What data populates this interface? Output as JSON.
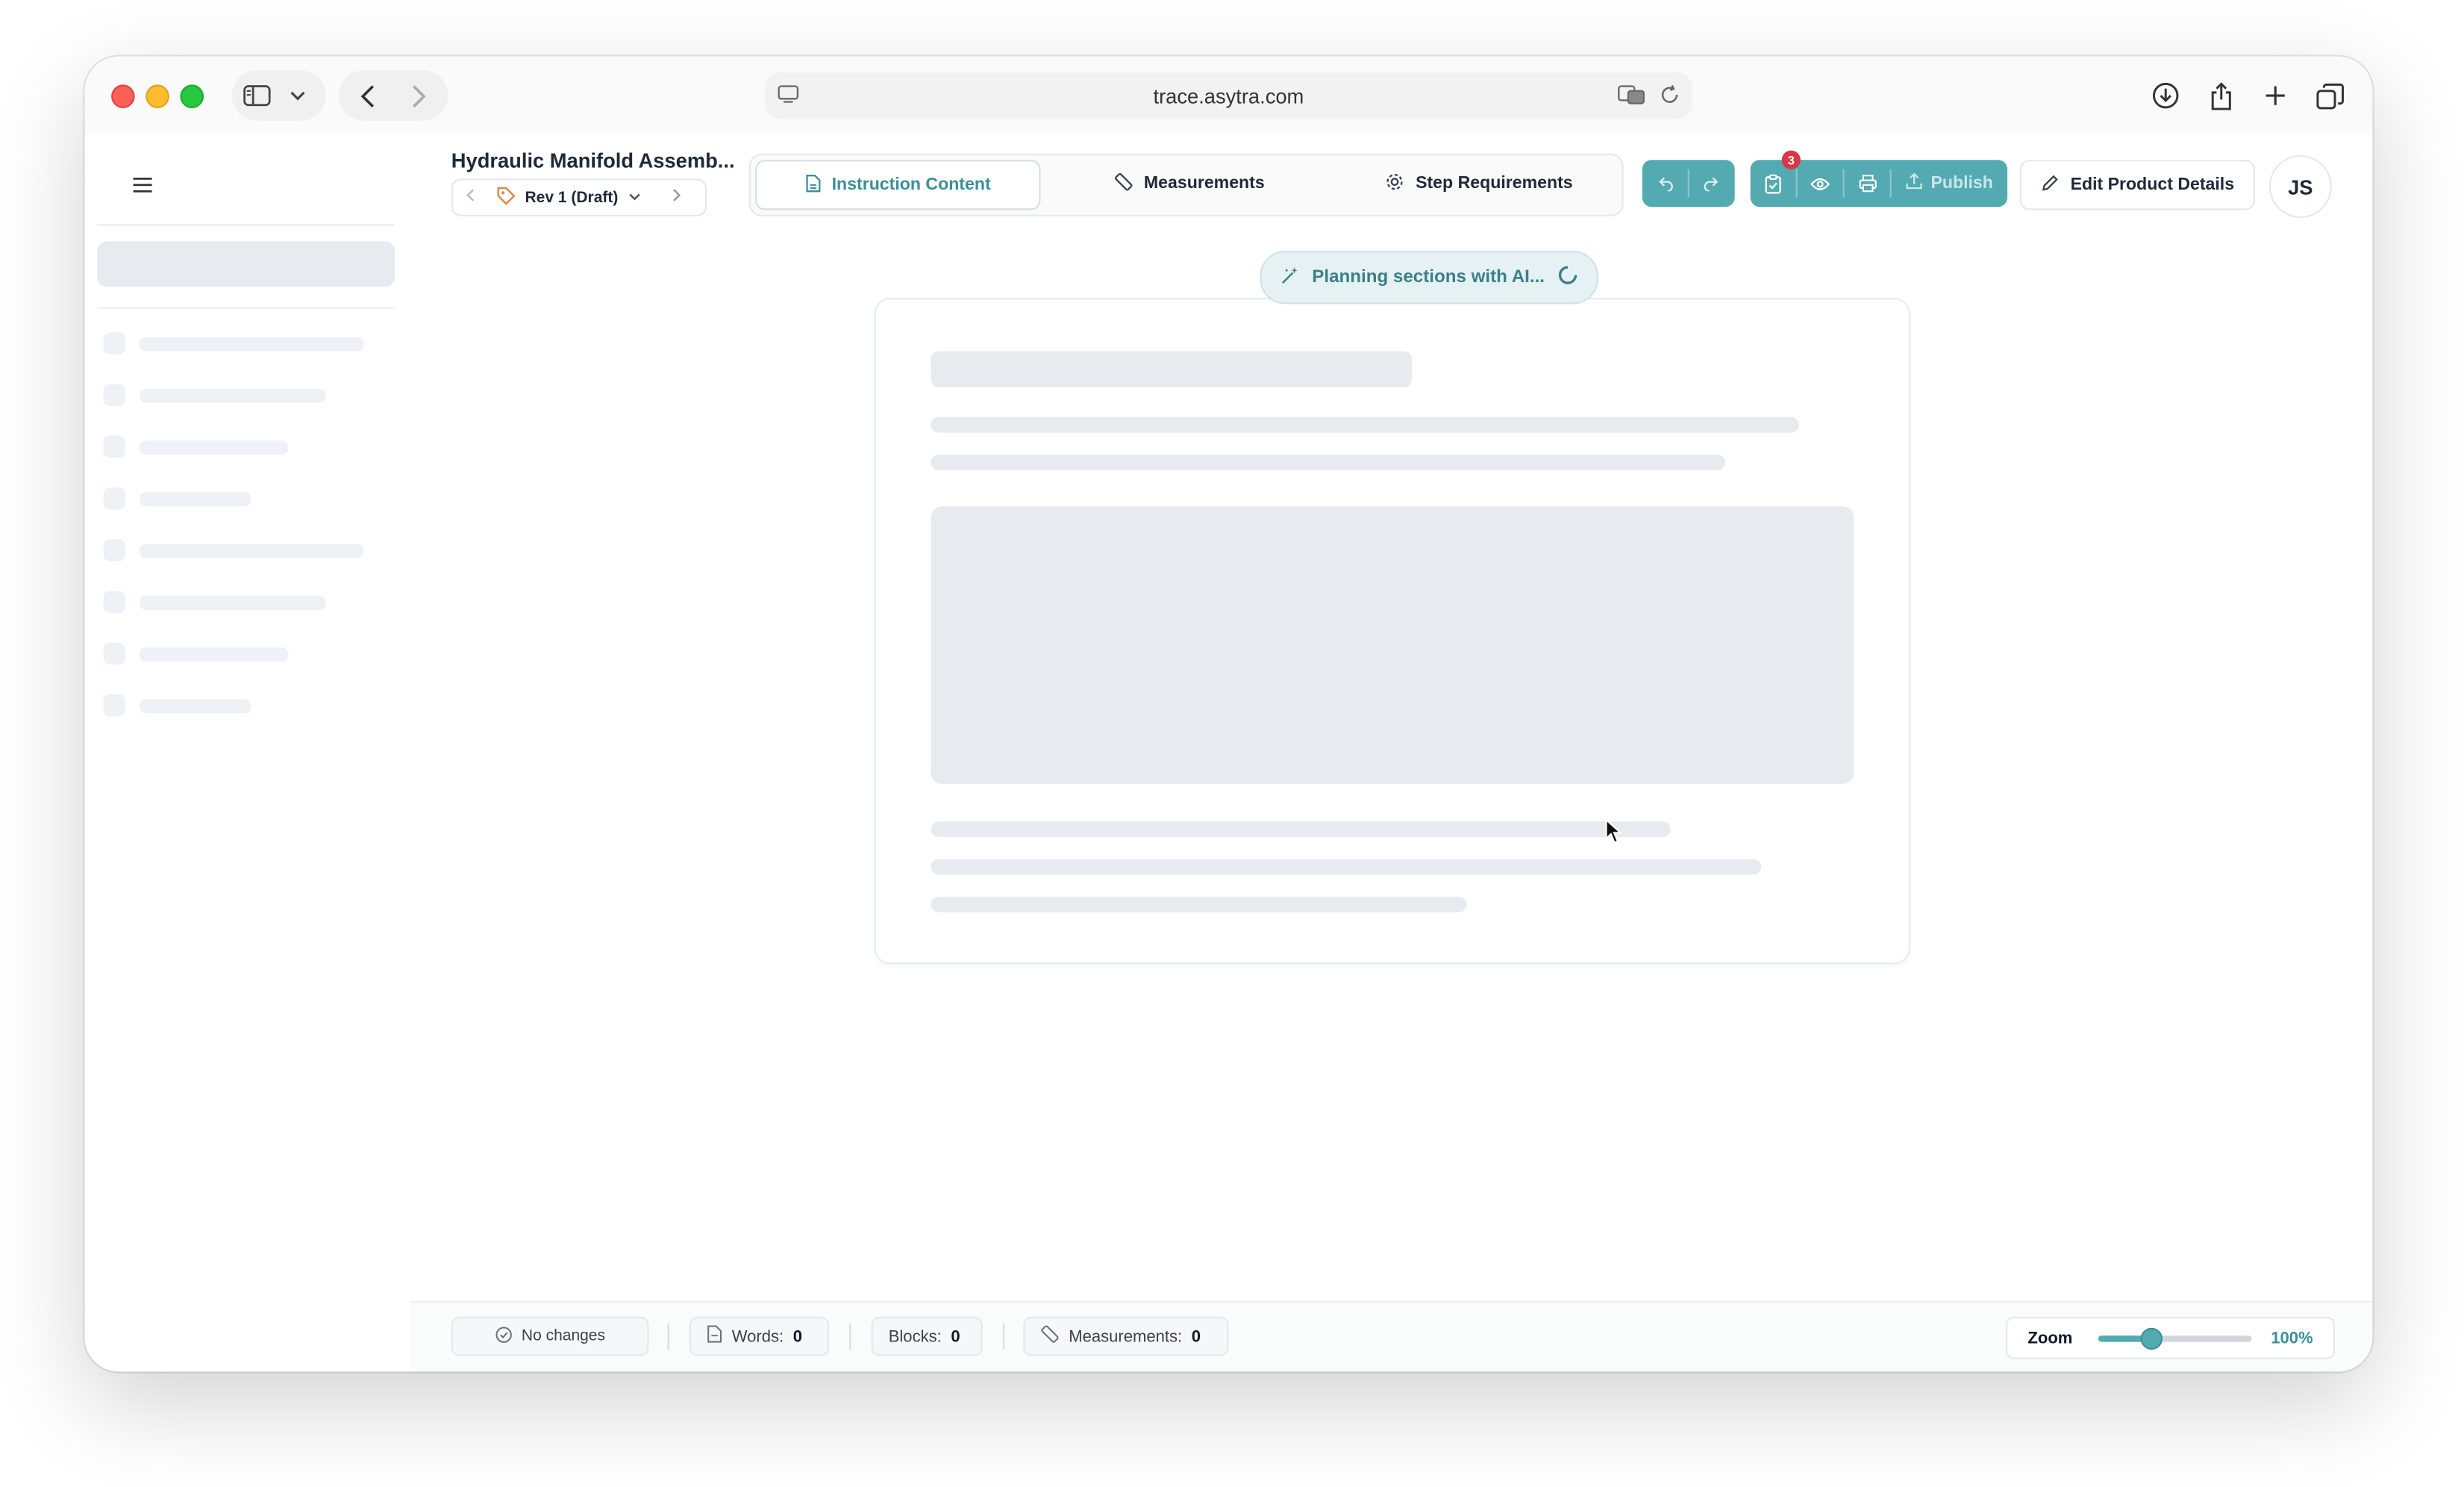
{
  "browser": {
    "url": "trace.asytra.com"
  },
  "header": {
    "product_title": "Hydraulic Manifold Assemb...",
    "revision": "Rev 1 (Draft)",
    "tabs": [
      {
        "label": "Instruction Content",
        "icon": "document-icon",
        "active": true
      },
      {
        "label": "Measurements",
        "icon": "ruler-icon",
        "active": false
      },
      {
        "label": "Step Requirements",
        "icon": "gear-icon",
        "active": false
      }
    ],
    "notification_count": "3",
    "publish_label": "Publish",
    "edit_label": "Edit Product Details",
    "avatar_initials": "JS"
  },
  "main": {
    "ai_status": "Planning sections with AI..."
  },
  "footer": {
    "status": "No changes",
    "words_label": "Words:",
    "words_value": "0",
    "blocks_label": "Blocks:",
    "blocks_value": "0",
    "measurements_label": "Measurements:",
    "measurements_value": "0",
    "zoom_label": "Zoom",
    "zoom_value": "100%",
    "zoom_fraction": 0.35
  },
  "colors": {
    "accent": "#54aab1",
    "accent_text": "#3a8f98",
    "badge": "#dc3545"
  }
}
